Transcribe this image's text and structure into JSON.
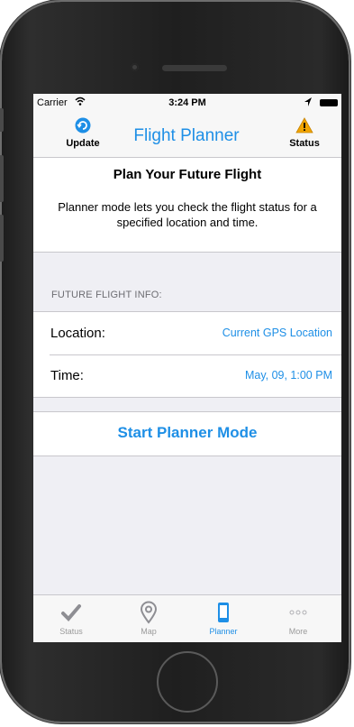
{
  "statusbar": {
    "carrier": "Carrier",
    "time": "3:24 PM"
  },
  "navbar": {
    "left_label": "Update",
    "title": "Flight Planner",
    "right_label": "Status"
  },
  "header": {
    "title": "Plan Your Future Flight",
    "description": "Planner mode lets you check the flight status for a specified location and time."
  },
  "section": {
    "header": "FUTURE FLIGHT INFO:",
    "rows": [
      {
        "label": "Location:",
        "value": "Current GPS Location"
      },
      {
        "label": "Time:",
        "value": "May, 09, 1:00 PM"
      }
    ]
  },
  "action": {
    "label": "Start Planner Mode"
  },
  "tabs": [
    {
      "label": "Status",
      "icon": "checkmark-icon",
      "active": false
    },
    {
      "label": "Map",
      "icon": "map-pin-icon",
      "active": false
    },
    {
      "label": "Planner",
      "icon": "phone-icon",
      "active": true
    },
    {
      "label": "More",
      "icon": "more-dots-icon",
      "active": false
    }
  ],
  "colors": {
    "accent": "#1e8fe6",
    "warning": "#f0a400",
    "background": "#efeff4"
  }
}
